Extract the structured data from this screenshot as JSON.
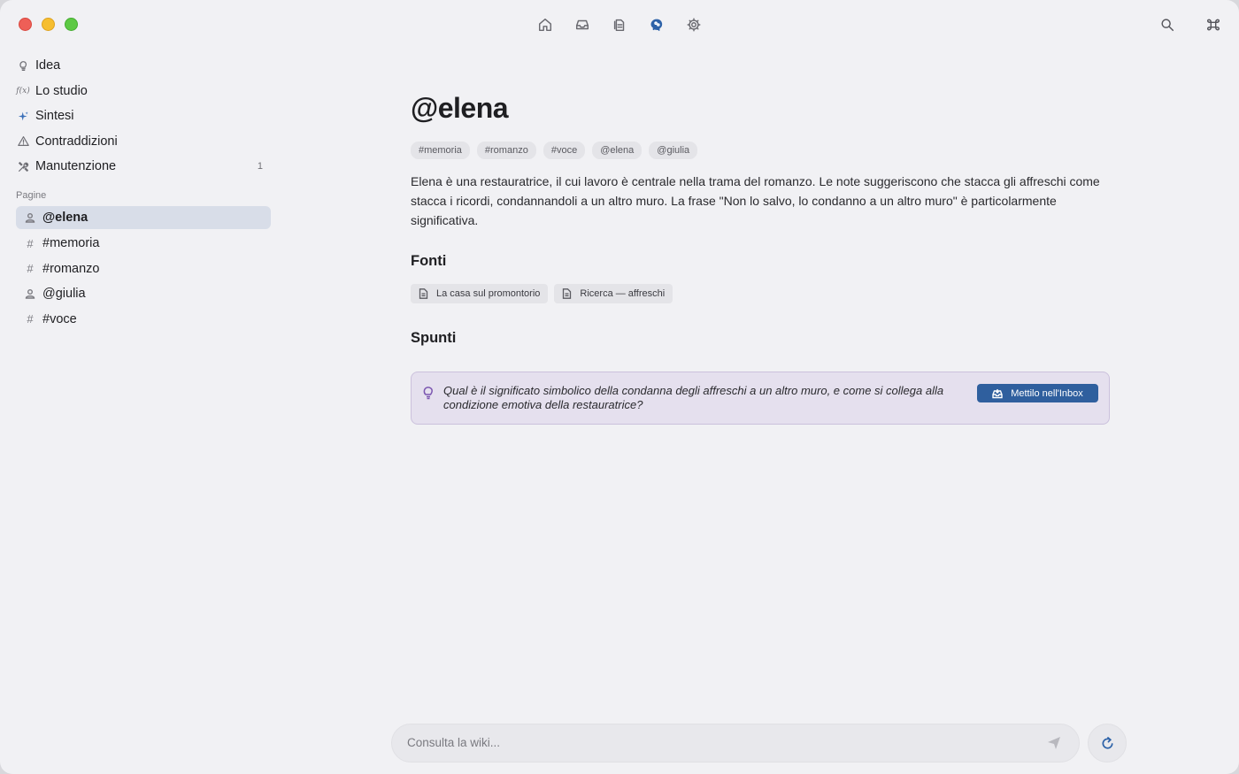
{
  "toolbar": {
    "center_icons": [
      "home-icon",
      "inbox-icon",
      "documents-icon",
      "brain-icon",
      "settings-icon"
    ],
    "active_icon": "brain-icon",
    "right_icons": [
      "search-icon",
      "command-icon"
    ]
  },
  "sidebar": {
    "nav": [
      {
        "label": "Idea",
        "icon": "lightbulb-icon"
      },
      {
        "label": "Lo studio",
        "icon": "function-icon",
        "icon_text": "f(x)"
      },
      {
        "label": "Sintesi",
        "icon": "sparkle-icon"
      },
      {
        "label": "Contraddizioni",
        "icon": "warning-icon"
      },
      {
        "label": "Manutenzione",
        "icon": "tools-icon",
        "count": "1"
      }
    ],
    "section_label": "Pagine",
    "pages": [
      {
        "label": "@elena",
        "icon": "person-icon",
        "selected": true
      },
      {
        "label": "#memoria",
        "icon": "hash-icon",
        "icon_text": "#"
      },
      {
        "label": "#romanzo",
        "icon": "hash-icon",
        "icon_text": "#"
      },
      {
        "label": "@giulia",
        "icon": "person-icon"
      },
      {
        "label": "#voce",
        "icon": "hash-icon",
        "icon_text": "#"
      }
    ]
  },
  "main": {
    "title": "@elena",
    "tags": [
      "#memoria",
      "#romanzo",
      "#voce",
      "@elena",
      "@giulia"
    ],
    "body": "Elena è una restauratrice, il cui lavoro è centrale nella trama del romanzo. Le note suggeriscono che stacca gli affreschi come stacca i ricordi, condannandoli a un altro muro. La frase \"Non lo salvo, lo condanno a un altro muro\" è particolarmente significativa.",
    "sources_heading": "Fonti",
    "sources": [
      "La casa sul promontorio",
      "Ricerca — affreschi"
    ],
    "ideas_heading": "Spunti",
    "idea": {
      "text": "Qual è il significato simbolico della condanna degli affreschi a un altro muro, e come si collega alla condizione emotiva della restauratrice?",
      "button_label": "Mettilo nell'Inbox"
    }
  },
  "ask": {
    "placeholder": "Consulta la wiki..."
  },
  "colors": {
    "accent": "#2f5f9e",
    "idea_bg": "#e5e0ee",
    "selected_bg": "#d8dde8",
    "window_bg": "#f1f1f4"
  }
}
